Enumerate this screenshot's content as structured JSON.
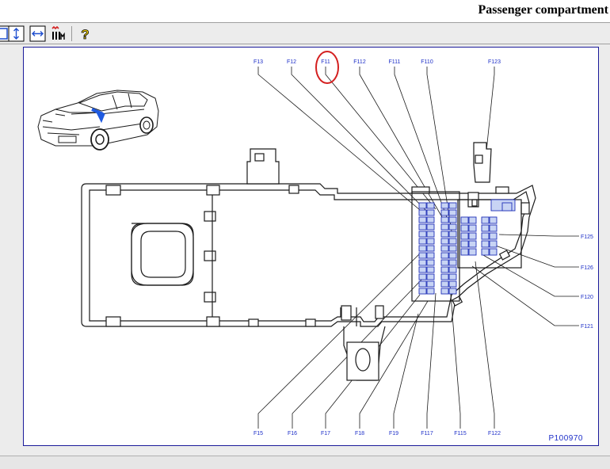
{
  "window": {
    "title": "Passenger compartment"
  },
  "toolbar": {
    "buttons": [
      {
        "icon": "fit-page-icon"
      },
      {
        "icon": "fit-height-icon"
      },
      {
        "icon": "fit-width-icon"
      },
      {
        "icon": "fuse-list-icon"
      },
      {
        "icon": "help-icon"
      }
    ]
  },
  "diagram": {
    "reference_code": "P100970",
    "fuse_labels_top": [
      "F13",
      "F12",
      "F11",
      "F112",
      "F111",
      "F110",
      "F123"
    ],
    "fuse_labels_bottom": [
      "F15",
      "F16",
      "F17",
      "F18",
      "F19",
      "F117",
      "F115",
      "F122"
    ],
    "fuse_labels_right": [
      "F125",
      "F126",
      "F120",
      "F121"
    ],
    "highlighted_fuse": "F11",
    "highlight_color": "#d42020",
    "line_color": "#1a1a1a",
    "label_color": "#1c2ec8",
    "fuse_fill": "#c8d4f4"
  }
}
